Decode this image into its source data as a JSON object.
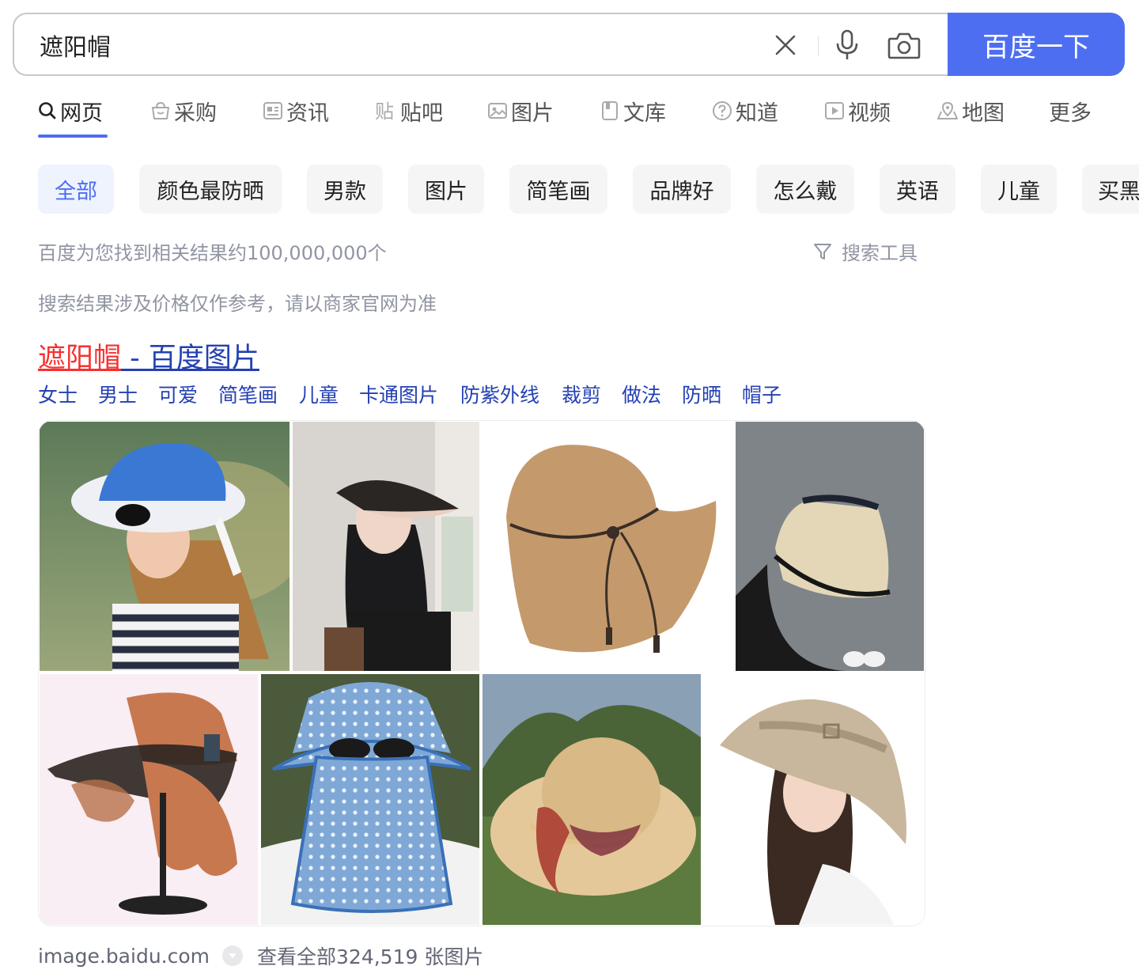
{
  "search": {
    "query": "遮阳帽",
    "button_label": "百度一下"
  },
  "tabs": [
    {
      "label": "网页",
      "icon": "search-icon",
      "active": true
    },
    {
      "label": "采购",
      "icon": "basket-icon"
    },
    {
      "label": "资讯",
      "icon": "news-icon"
    },
    {
      "label": "贴吧",
      "icon": "tieba-icon"
    },
    {
      "label": "图片",
      "icon": "image-icon"
    },
    {
      "label": "文库",
      "icon": "doc-icon"
    },
    {
      "label": "知道",
      "icon": "question-icon"
    },
    {
      "label": "视频",
      "icon": "play-icon"
    },
    {
      "label": "地图",
      "icon": "map-icon"
    },
    {
      "label": "更多"
    }
  ],
  "chips": [
    "全部",
    "颜色最防晒",
    "男款",
    "图片",
    "简笔画",
    "品牌好",
    "怎么戴",
    "英语",
    "儿童",
    "买黑"
  ],
  "results": {
    "count_text": "百度为您找到相关结果约100,000,000个",
    "tools_label": "搜索工具",
    "price_note": "搜索结果涉及价格仅作参考，请以商家官网为准"
  },
  "image_result": {
    "title_highlight": "遮阳帽",
    "title_rest": " - 百度图片",
    "related": [
      "女士",
      "男士",
      "可爱",
      "简笔画",
      "儿童",
      "卡通图片",
      "防紫外线",
      "裁剪",
      "做法",
      "防晒",
      "帽子"
    ],
    "source": "image.baidu.com",
    "view_all": "查看全部324,519 张图片"
  },
  "colors": {
    "brand": "#4e6ef2",
    "link": "#2440b3",
    "highlight": "#f73131",
    "muted": "#9195a3"
  }
}
